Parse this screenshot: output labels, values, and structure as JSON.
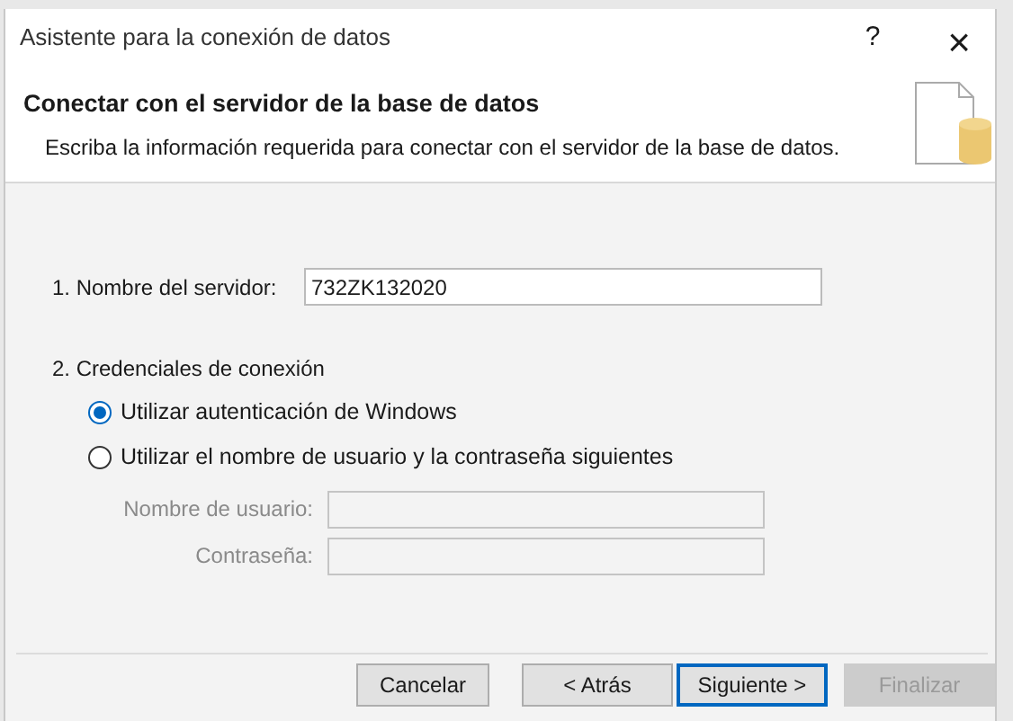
{
  "window": {
    "title": "Asistente para la conexión de datos",
    "help": "?",
    "close": "×"
  },
  "header": {
    "title": "Conectar con el servidor de la base de datos",
    "subtitle": "Escriba la información requerida para conectar con el servidor de la base de datos."
  },
  "server": {
    "label": "1. Nombre del servidor:",
    "value": "732ZK132020"
  },
  "credentials": {
    "label": "2. Credenciales de conexión",
    "options": [
      {
        "label": "Utilizar autenticación de Windows",
        "selected": true
      },
      {
        "label": "Utilizar el nombre de usuario y la contraseña siguientes",
        "selected": false
      }
    ],
    "fields": [
      {
        "label": "Nombre de usuario:",
        "disabled": true
      },
      {
        "label": "Contraseña:",
        "disabled": true
      }
    ]
  },
  "buttons": [
    {
      "label": "Cancelar",
      "default": false,
      "disabled": false
    },
    {
      "label": "< Atrás",
      "default": false,
      "disabled": false
    },
    {
      "label": "Siguiente >",
      "default": true,
      "disabled": false
    },
    {
      "label": "Finalizar",
      "default": false,
      "disabled": true
    }
  ]
}
